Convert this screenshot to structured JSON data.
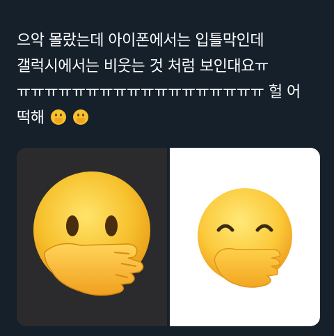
{
  "tweet": {
    "lines": [
      "으악 몰랐는데 아이폰에서는 입틀막인데",
      "갤럭시에서는 비웃는 것 처럼 보인대요ㅠ",
      "ㅠㅠㅠㅠㅠㅠㅠㅠㅠㅠㅠㅠㅠㅠㅠㅠㅠㅠ 헐 어",
      "떡해"
    ],
    "trailing_emoji": [
      "hand-over-mouth-emoji",
      "hand-over-mouth-emoji"
    ]
  },
  "media": {
    "left_image": "iphone-hand-over-mouth-emoji",
    "right_image": "samsung-hand-over-mouth-emoji",
    "left_background": "#2b2b2d",
    "right_background": "#ffffff"
  },
  "colors": {
    "background": "#15202b",
    "text": "#ffffff",
    "emoji_face": "#f7c12e",
    "emoji_hand": "#f5b62a"
  }
}
